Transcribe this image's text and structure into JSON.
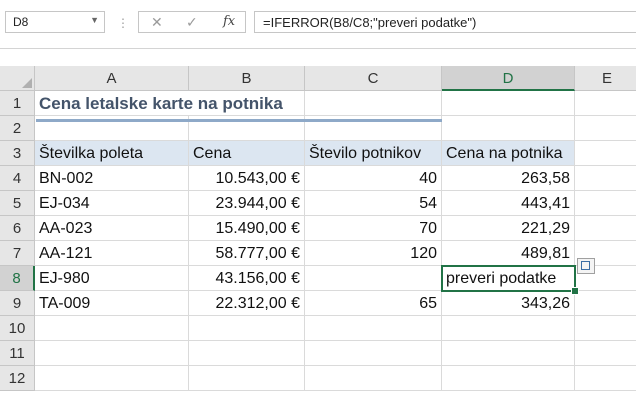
{
  "formula_bar": {
    "name_box": "D8",
    "fx_label": "fx",
    "cancel_glyph": "✕",
    "enter_glyph": "✓",
    "formula": "=IFERROR(B8/C8;\"preveri podatke\")"
  },
  "columns": [
    "A",
    "B",
    "C",
    "D",
    "E"
  ],
  "rows": [
    "1",
    "2",
    "3",
    "4",
    "5",
    "6",
    "7",
    "8",
    "9",
    "10",
    "11",
    "12"
  ],
  "title": "Cena letalske karte na potnika",
  "headers": [
    "Številka poleta",
    "Cena",
    "Število potnikov",
    "Cena na potnika"
  ],
  "data": [
    [
      "BN-002",
      "10.543,00 €",
      "40",
      "263,58"
    ],
    [
      "EJ-034",
      "23.944,00 €",
      "54",
      "443,41"
    ],
    [
      "AA-023",
      "15.490,00 €",
      "70",
      "221,29"
    ],
    [
      "AA-121",
      "58.777,00 €",
      "120",
      "489,81"
    ],
    [
      "EJ-980",
      "43.156,00 €",
      "",
      "preveri podatke"
    ],
    [
      "TA-009",
      "22.312,00 €",
      "65",
      "343,26"
    ]
  ],
  "active_cell": "D8",
  "colors": {
    "accent": "#217346",
    "header_fill": "#dce6f1",
    "title_color": "#44546a"
  }
}
